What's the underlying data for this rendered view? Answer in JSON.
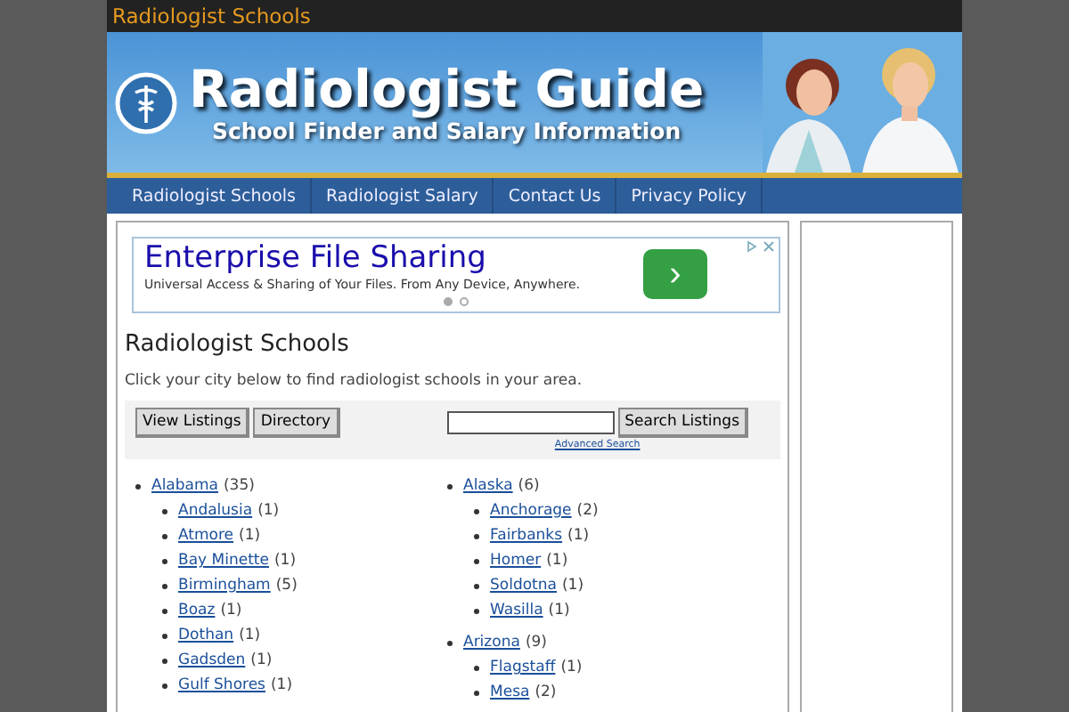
{
  "site_title": "Radiologist Schools",
  "banner": {
    "headline": "Radiologist Guide",
    "tagline": "School Finder and Salary Information"
  },
  "nav": [
    {
      "label": "Radiologist Schools"
    },
    {
      "label": "Radiologist Salary"
    },
    {
      "label": "Contact Us"
    },
    {
      "label": "Privacy Policy"
    }
  ],
  "ad": {
    "title": "Enterprise File Sharing",
    "text": "Universal Access & Sharing of Your Files. From Any Device, Anywhere.",
    "button": "›",
    "dots": [
      {
        "selected": true
      },
      {
        "selected": false
      }
    ]
  },
  "heading": "Radiologist Schools",
  "intro": "Click your city below to find radiologist schools in your area.",
  "toolbar": {
    "buttons": [
      "View Listings",
      "Directory"
    ],
    "search_button": "Search Listings",
    "advanced_link": "Advanced Search"
  },
  "columns": [
    [
      {
        "state": "Alabama",
        "count": "(35)",
        "cities": [
          {
            "name": "Andalusia",
            "count": "(1)"
          },
          {
            "name": "Atmore",
            "count": "(1)"
          },
          {
            "name": "Bay Minette",
            "count": "(1)"
          },
          {
            "name": "Birmingham",
            "count": "(5)"
          },
          {
            "name": "Boaz",
            "count": "(1)"
          },
          {
            "name": "Dothan",
            "count": "(1)"
          },
          {
            "name": "Gadsden",
            "count": "(1)"
          },
          {
            "name": "Gulf Shores",
            "count": "(1)"
          }
        ]
      }
    ],
    [
      {
        "state": "Alaska",
        "count": "(6)",
        "cities": [
          {
            "name": "Anchorage",
            "count": "(2)"
          },
          {
            "name": "Fairbanks",
            "count": "(1)"
          },
          {
            "name": "Homer",
            "count": "(1)"
          },
          {
            "name": "Soldotna",
            "count": "(1)"
          },
          {
            "name": "Wasilla",
            "count": "(1)"
          }
        ]
      },
      {
        "state": "Arizona",
        "count": "(9)",
        "cities": [
          {
            "name": "Flagstaff",
            "count": "(1)"
          },
          {
            "name": "Mesa",
            "count": "(2)"
          }
        ]
      }
    ]
  ]
}
